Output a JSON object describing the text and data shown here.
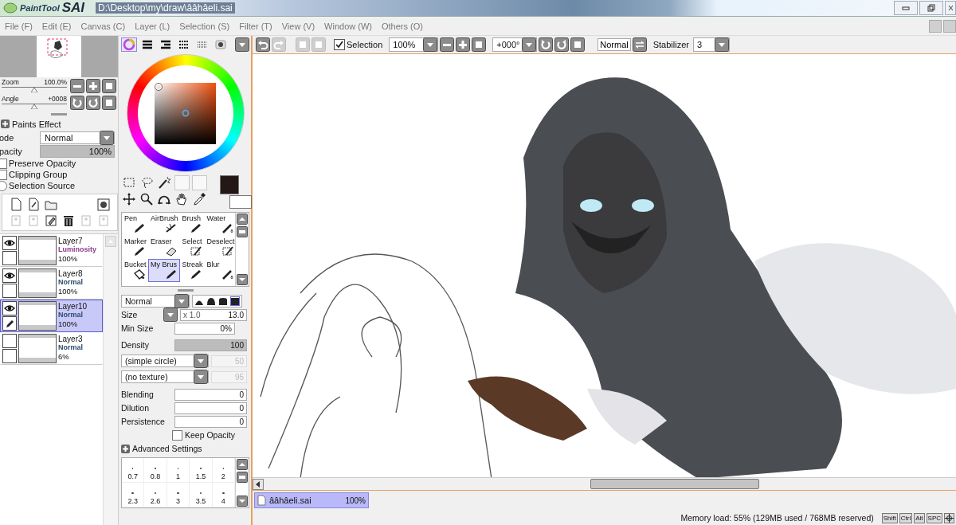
{
  "title_bar": {
    "logo_small": "PaintTool",
    "logo_large": "SAI",
    "file_path": "D:\\Desktop\\my\\draw\\ââhâeli.sai"
  },
  "menu": [
    "File (F)",
    "Edit (E)",
    "Canvas (C)",
    "Layer (L)",
    "Selection (S)",
    "Filter (T)",
    "View (V)",
    "Window (W)",
    "Others (O)"
  ],
  "navigator": {
    "zoom": {
      "label": "Zoom",
      "value": "100.0%",
      "level": 0.5
    },
    "angle": {
      "label": "Angle",
      "value": "+0008",
      "level": 0.5
    }
  },
  "layer_properties": {
    "paints_effect": "Paints Effect",
    "mode_label": "ode",
    "mode": "Normal",
    "opacity_label": "pacity",
    "opacity": {
      "value": "100%",
      "level": 1
    },
    "options": [
      {
        "kind": "checkbox",
        "label": "Preserve Opacity",
        "checked": false
      },
      {
        "kind": "checkbox",
        "label": "Clipping Group",
        "checked": false
      },
      {
        "kind": "radio",
        "label": "Selection Source",
        "checked": false
      }
    ]
  },
  "layers": [
    {
      "name": "Layer7",
      "mode": "Luminosity",
      "opacity": "100%",
      "color": "#8a3c8a",
      "visible": true,
      "editing": false,
      "selected": false
    },
    {
      "name": "Layer8",
      "mode": "Normal",
      "opacity": "100%",
      "color": "#2c4a6e",
      "visible": true,
      "editing": false,
      "selected": false
    },
    {
      "name": "Layer10",
      "mode": "Normal",
      "opacity": "100%",
      "color": "#2c4a6e",
      "visible": true,
      "editing": true,
      "selected": true
    },
    {
      "name": "Layer3",
      "mode": "Normal",
      "opacity": "6%",
      "color": "#2c4a6e",
      "visible": false,
      "editing": false,
      "selected": false
    }
  ],
  "color_tabs": [
    {
      "selected": true
    },
    {
      "selected": false
    },
    {
      "selected": false
    },
    {
      "selected": false
    },
    {
      "selected": false
    },
    {
      "selected": false
    }
  ],
  "current_colors": [
    {
      "kind": "primary",
      "color": "#231815"
    },
    {
      "kind": "secondary",
      "color": "#ffffff"
    }
  ],
  "brush_tools": [
    {
      "label": "Pen",
      "selected": false
    },
    {
      "label": "AirBrush",
      "selected": false
    },
    {
      "label": "Brush",
      "selected": false
    },
    {
      "label": "Water",
      "selected": false
    },
    {
      "label": "Marker",
      "selected": false
    },
    {
      "label": "Eraser",
      "selected": false
    },
    {
      "label": "Select",
      "selected": false
    },
    {
      "label": "Deselect",
      "selected": false
    },
    {
      "label": "Bucket",
      "selected": false
    },
    {
      "label": "My Brus",
      "selected": true
    },
    {
      "label": "Streak",
      "selected": false
    },
    {
      "label": "Blur",
      "selected": false
    }
  ],
  "brush_settings": {
    "blend_mode": "Normal",
    "shapes": [
      {
        "selected": false
      },
      {
        "selected": false
      },
      {
        "selected": false
      },
      {
        "selected": true
      }
    ],
    "size": {
      "label": "Size",
      "multiplier": "x 1.0",
      "value": "13.0"
    },
    "min_size": {
      "label": "Min Size",
      "value": "0%"
    },
    "density": {
      "label": "Density",
      "value": "100",
      "level": 1
    },
    "shape": {
      "value": "(simple circle)",
      "amount": "50"
    },
    "texture": {
      "value": "(no texture)",
      "amount": "95"
    },
    "sliders": [
      {
        "label": "Blending",
        "value": "0",
        "level": 0
      },
      {
        "label": "Dilution",
        "value": "0",
        "level": 0
      },
      {
        "label": "Persistence",
        "value": "0",
        "level": 0
      }
    ],
    "keep_opacity": {
      "label": "Keep Opacity",
      "checked": false
    },
    "advanced": "Advanced Settings",
    "sizes": [
      "0.7",
      "0.8",
      "1",
      "1.5",
      "2",
      "2.3",
      "2.6",
      "3",
      "3.5",
      "4"
    ]
  },
  "canvas_toolbar": {
    "selection": {
      "label": "Selection",
      "checked": true
    },
    "zoom": "100%",
    "angle": "+000°",
    "blend": "Normal",
    "stabilizer_label": "Stabilizer",
    "stabilizer": "3"
  },
  "document_tabs": [
    {
      "name": "ââhâeli.sai",
      "zoom": "100%",
      "selected": true
    }
  ],
  "status_bar": {
    "memory": "Memory load: 55% (129MB used / 768MB reserved)",
    "keys": [
      "Shift",
      "Ctrl",
      "Alt",
      "SPC"
    ]
  }
}
